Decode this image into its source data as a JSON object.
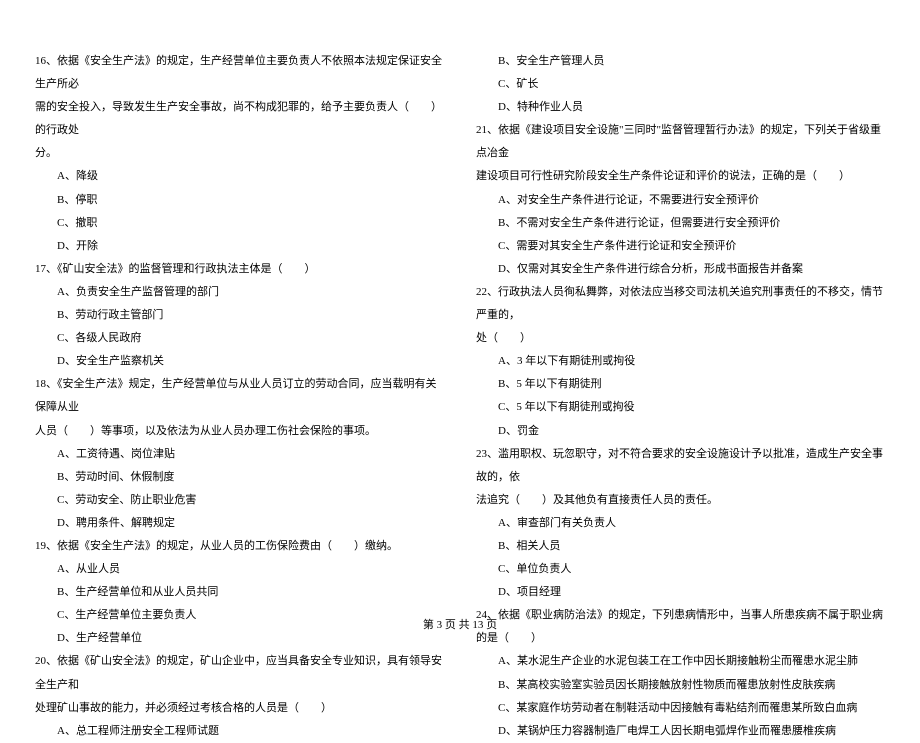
{
  "left": {
    "q16": {
      "line1": "16、依据《安全生产法》的规定，生产经营单位主要负责人不依照本法规定保证安全生产所必",
      "line2": "需的安全投入，导致发生生产安全事故，尚不构成犯罪的，给予主要负责人（　　）的行政处",
      "line3": "分。",
      "optA": "A、降级",
      "optB": "B、停职",
      "optC": "C、撤职",
      "optD": "D、开除"
    },
    "q17": {
      "line1": "17、《矿山安全法》的监督管理和行政执法主体是（　　）",
      "optA": "A、负责安全生产监督管理的部门",
      "optB": "B、劳动行政主管部门",
      "optC": "C、各级人民政府",
      "optD": "D、安全生产监察机关"
    },
    "q18": {
      "line1": "18、《安全生产法》规定，生产经营单位与从业人员订立的劳动合同，应当载明有关保障从业",
      "line2": "人员（　　）等事项，以及依法为从业人员办理工伤社会保险的事项。",
      "optA": "A、工资待遇、岗位津贴",
      "optB": "B、劳动时间、休假制度",
      "optC": "C、劳动安全、防止职业危害",
      "optD": "D、聘用条件、解聘规定"
    },
    "q19": {
      "line1": "19、依据《安全生产法》的规定，从业人员的工伤保险费由（　　）缴纳。",
      "optA": "A、从业人员",
      "optB": "B、生产经营单位和从业人员共同",
      "optC": "C、生产经营单位主要负责人",
      "optD": "D、生产经营单位"
    },
    "q20": {
      "line1": "20、依据《矿山安全法》的规定，矿山企业中，应当具备安全专业知识，具有领导安全生产和",
      "line2": "处理矿山事故的能力，并必须经过考核合格的人员是（　　）",
      "optA": "A、总工程师注册安全工程师试题"
    }
  },
  "right": {
    "q20cont": {
      "optB": "B、安全生产管理人员",
      "optC": "C、矿长",
      "optD": "D、特种作业人员"
    },
    "q21": {
      "line1": "21、依据《建设项目安全设施\"三同时\"监督管理暂行办法》的规定，下列关于省级重点冶金",
      "line2": "建设项目可行性研究阶段安全生产条件论证和评价的说法，正确的是（　　）",
      "optA": "A、对安全生产条件进行论证，不需要进行安全预评价",
      "optB": "B、不需对安全生产条件进行论证，但需要进行安全预评价",
      "optC": "C、需要对其安全生产条件进行论证和安全预评价",
      "optD": "D、仅需对其安全生产条件进行综合分析，形成书面报告并备案"
    },
    "q22": {
      "line1": "22、行政执法人员徇私舞弊，对依法应当移交司法机关追究刑事责任的不移交，情节严重的，",
      "line2": "处（　　）",
      "optA": "A、3 年以下有期徒刑或拘役",
      "optB": "B、5 年以下有期徒刑",
      "optC": "C、5 年以下有期徒刑或拘役",
      "optD": "D、罚金"
    },
    "q23": {
      "line1": "23、滥用职权、玩忽职守，对不符合要求的安全设施设计予以批准，造成生产安全事故的，依",
      "line2": "法追究（　　）及其他负有直接责任人员的责任。",
      "optA": "A、审查部门有关负责人",
      "optB": "B、相关人员",
      "optC": "C、单位负责人",
      "optD": "D、项目经理"
    },
    "q24": {
      "line1": "24、依据《职业病防治法》的规定，下列患病情形中，当事人所患疾病不属于职业病的是（　　）",
      "optA": "A、某水泥生产企业的水泥包装工在工作中因长期接触粉尘而罹患水泥尘肺",
      "optB": "B、某高校实验室实验员因长期接触放射性物质而罹患放射性皮肤疾病",
      "optC": "C、某家庭作坊劳动者在制鞋活动中因接触有毒粘结剂而罹患某所致白血病",
      "optD": "D、某锅炉压力容器制造厂电焊工人因长期电弧焊作业而罹患腰椎疾病"
    }
  },
  "footer": "第 3 页 共 13 页"
}
